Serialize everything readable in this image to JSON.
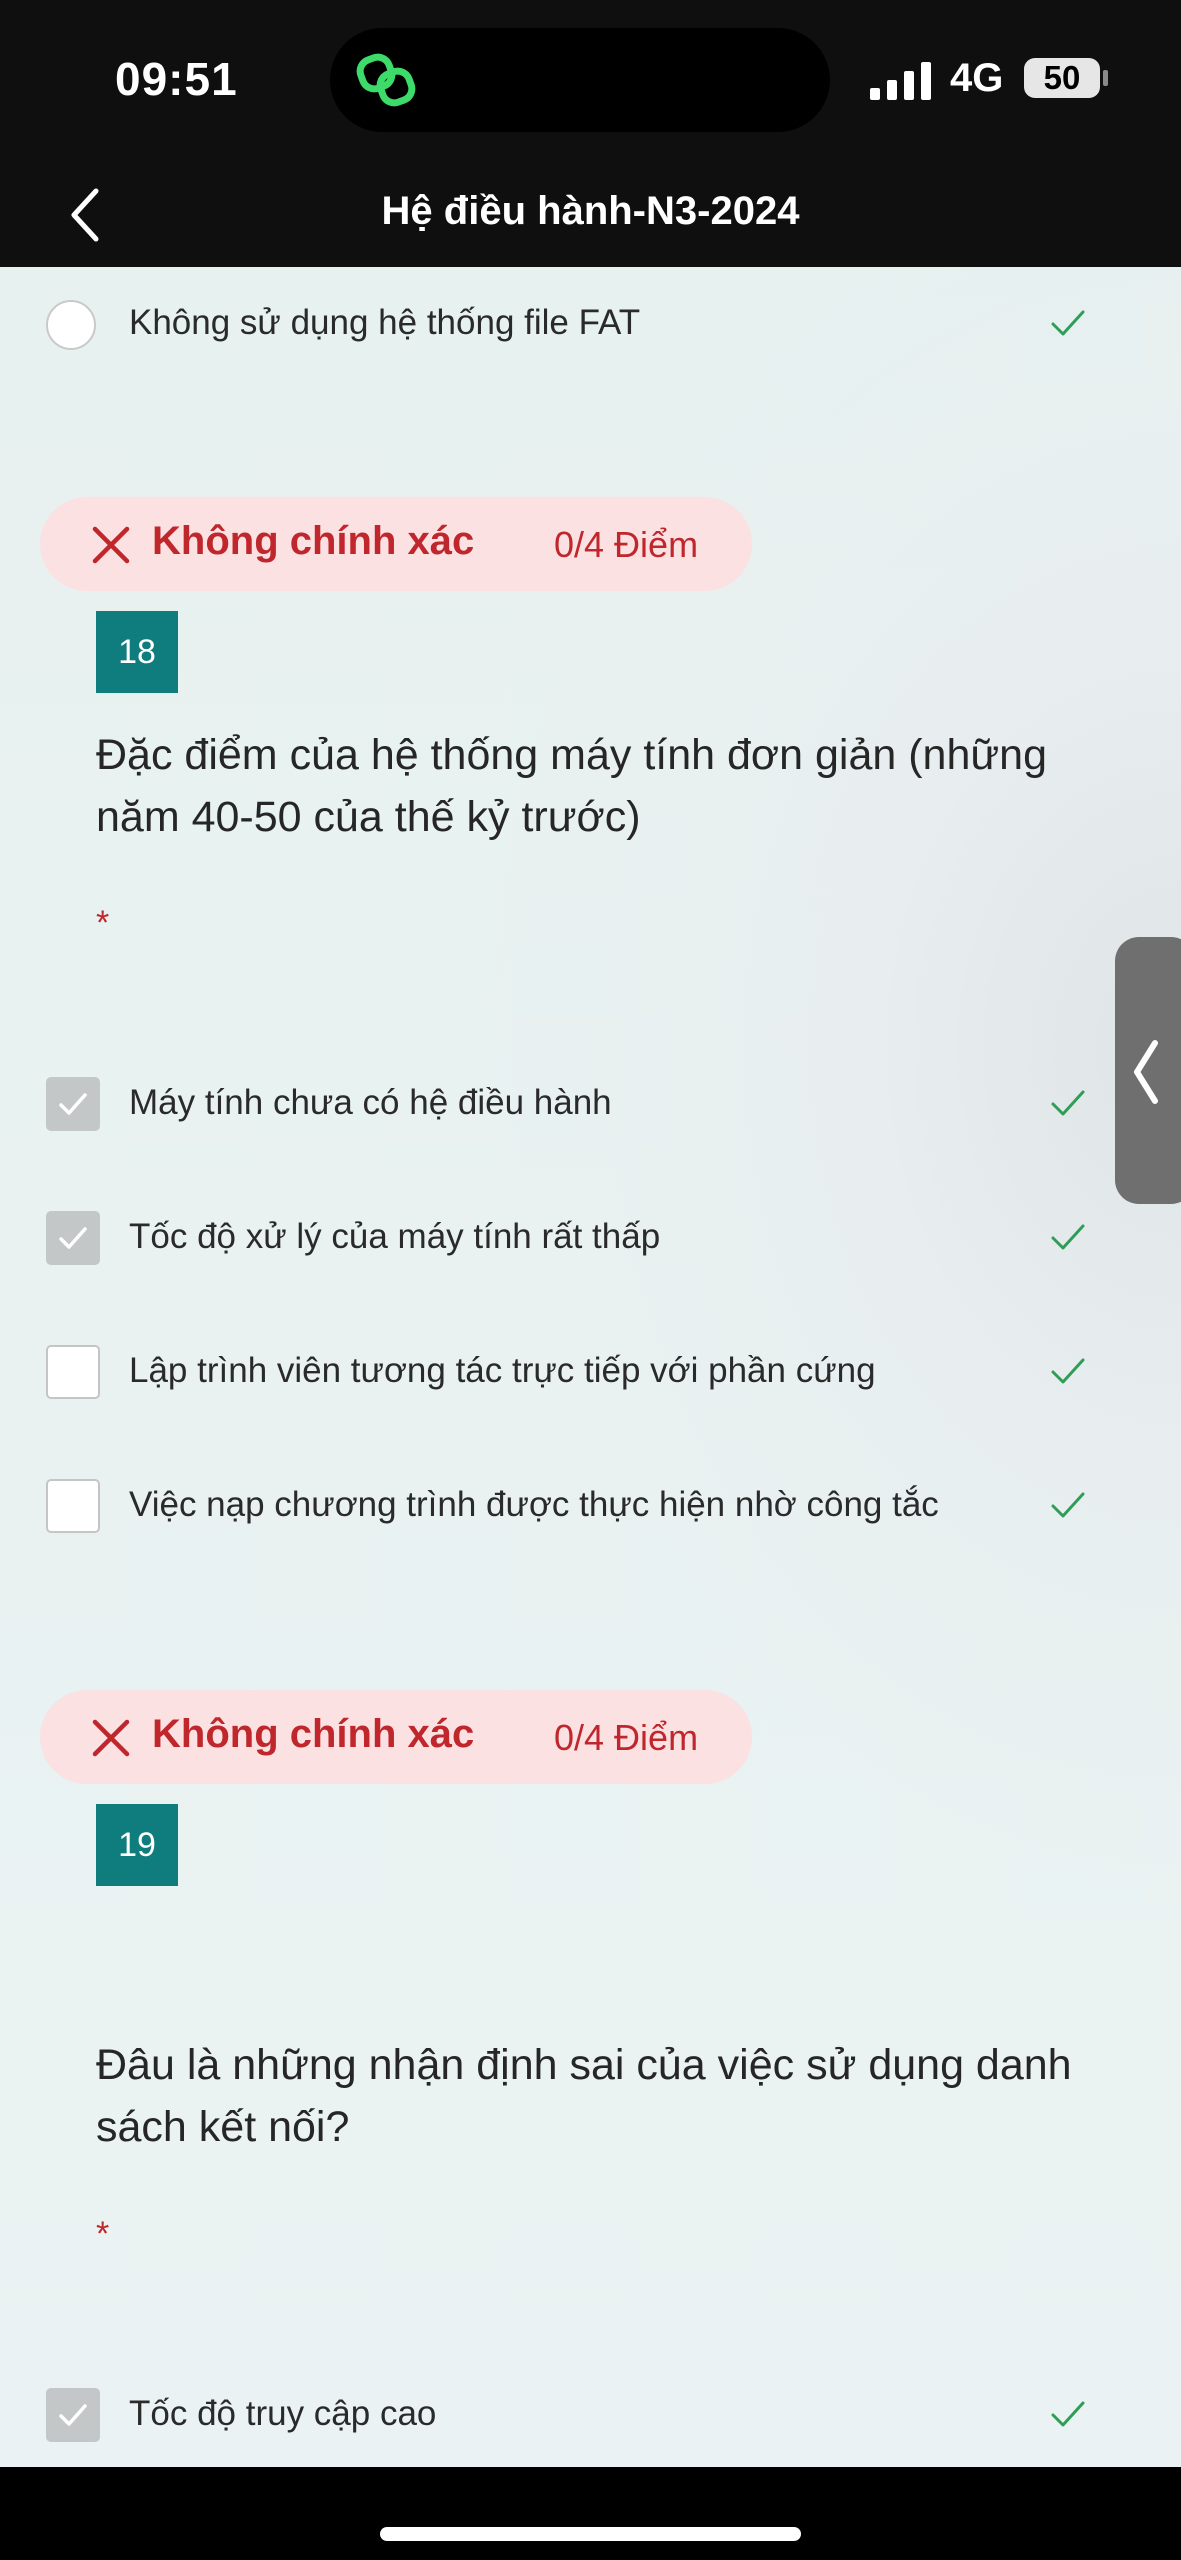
{
  "status_bar": {
    "time": "09:51",
    "network": "4G",
    "battery": "50"
  },
  "nav": {
    "title": "Hệ điều hành-N3-2024"
  },
  "top_option": {
    "label": "Không sử dụng hệ thống file FAT"
  },
  "questions": [
    {
      "status": "Không chính xác",
      "score": "0/4 Điểm",
      "number": "18",
      "text": "Đặc điểm của hệ thống máy tính đơn giản (những năm 40-50 của thế kỷ trước)",
      "required_mark": "*",
      "options": [
        {
          "label": "Máy tính chưa có hệ điều hành",
          "checked": true
        },
        {
          "label": "Tốc độ xử lý của máy tính rất thấp",
          "checked": true
        },
        {
          "label": "Lập trình viên tương tác trực tiếp với phần cứng",
          "checked": false
        },
        {
          "label": "Việc nạp chương trình được thực hiện nhờ công tắc",
          "checked": false
        }
      ]
    },
    {
      "status": "Không chính xác",
      "score": "0/4 Điểm",
      "number": "19",
      "text": "Đâu là những nhận định sai của việc sử dụng danh sách kết nối?",
      "required_mark": "*",
      "options": [
        {
          "label": "Tốc độ truy cập cao",
          "checked": true
        }
      ]
    }
  ],
  "colors": {
    "accent_teal": "#0f7c7d",
    "error_red": "#c0272d",
    "error_bg": "#fbe1e2",
    "tick_green": "#2e9e57"
  }
}
